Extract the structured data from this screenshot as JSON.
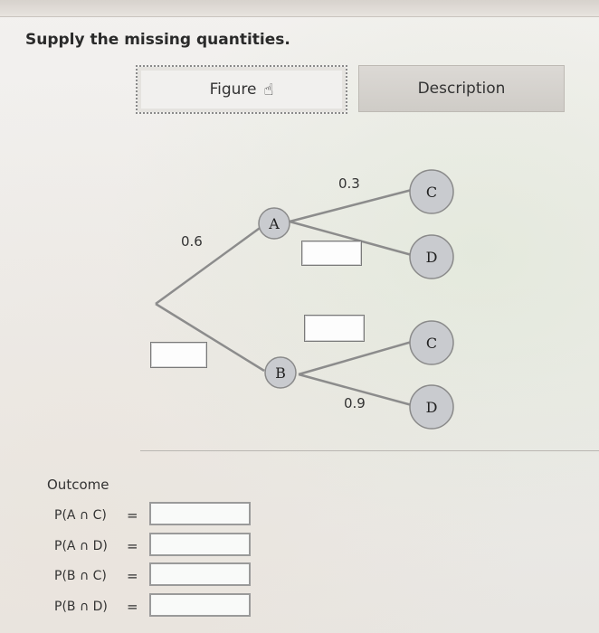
{
  "prompt": "Supply the missing quantities.",
  "tabs": {
    "figure_label": "Figure",
    "description_label": "Description"
  },
  "tree": {
    "nodes": {
      "a": "A",
      "b": "B",
      "c1": "C",
      "d1": "D",
      "c2": "C",
      "d2": "D"
    },
    "values": {
      "p_a": "0.6",
      "p_c_given_a": "0.3",
      "p_d_given_b": "0.9"
    }
  },
  "outcomes": {
    "heading": "Outcome",
    "rows": [
      {
        "label": "P(A ∩ C)",
        "eq": "="
      },
      {
        "label": "P(A ∩ D)",
        "eq": "="
      },
      {
        "label": "P(B ∩ C)",
        "eq": "="
      },
      {
        "label": "P(B ∩ D)",
        "eq": "="
      }
    ]
  },
  "icons": {
    "cursor": "hand-pointer-icon"
  },
  "colors": {
    "node_fill": "#c9cbcf",
    "branch": "#8c8c8c"
  }
}
